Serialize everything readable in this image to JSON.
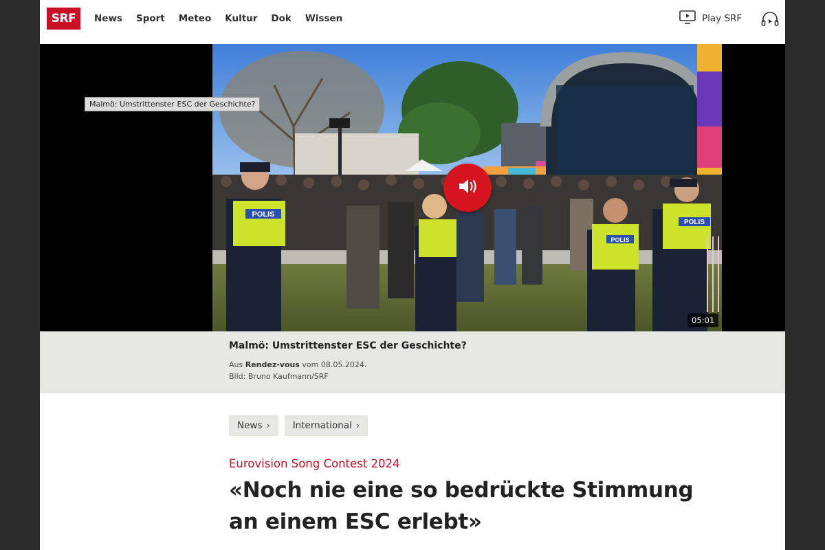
{
  "header": {
    "logo": "SRF",
    "nav": [
      "News",
      "Sport",
      "Meteo",
      "Kultur",
      "Dok",
      "Wissen"
    ],
    "play_label": "Play SRF"
  },
  "video": {
    "tooltip": "Malmö: Umstrittenster ESC der Geschichte?",
    "duration": "05:01",
    "police_label": "POLIS"
  },
  "caption": {
    "title": "Malmö: Umstrittenster ESC der Geschichte?",
    "source_prefix": "Aus ",
    "source_show": "Rendez-vous",
    "source_suffix": " vom 08.05.2024.",
    "credit": "Bild: Bruno Kaufmann/SRF"
  },
  "article": {
    "breadcrumbs": [
      "News",
      "International"
    ],
    "kicker": "Eurovision Song Contest 2024",
    "headline": "«Noch nie eine so bedrückte Stimmung an einem ESC erlebt»"
  },
  "colors": {
    "brand_red": "#c91024",
    "mute_button": "#d6141f",
    "caption_bg": "#e7e7e4"
  }
}
